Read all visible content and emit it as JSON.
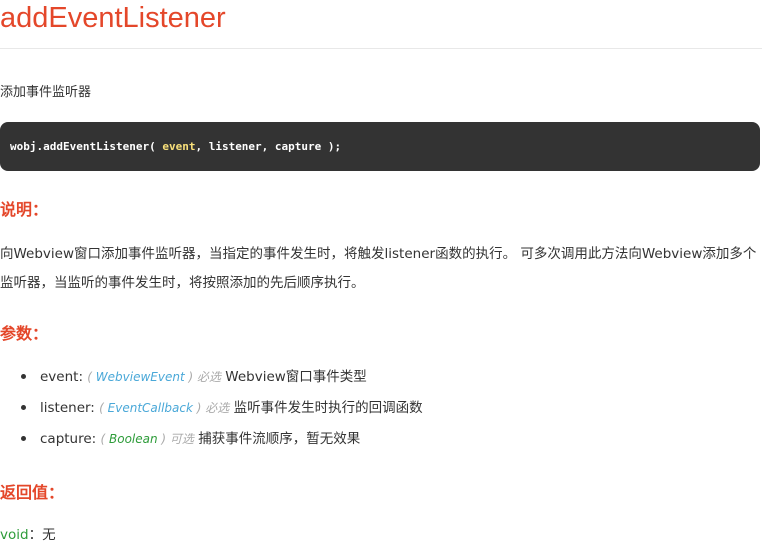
{
  "title": "addEventListener",
  "intro": "添加事件监听器",
  "code": {
    "prefix": "wobj.addEventListener( ",
    "arg": "event",
    "suffix": ", listener, capture );"
  },
  "description": {
    "heading": "说明：",
    "text": "向Webview窗口添加事件监听器，当指定的事件发生时，将触发listener函数的执行。 可多次调用此方法向Webview添加多个监听器，当监听的事件发生时，将按照添加的先后顺序执行。"
  },
  "params": {
    "heading": "参数：",
    "items": [
      {
        "name": "event: ",
        "open": "( ",
        "type": "WebviewEvent",
        "close": " ) ",
        "requirement": "必选",
        "desc": " Webview窗口事件类型"
      },
      {
        "name": "listener: ",
        "open": "( ",
        "type": "EventCallback",
        "close": " ) ",
        "requirement": "必选",
        "desc": " 监听事件发生时执行的回调函数"
      },
      {
        "name": "capture: ",
        "open": "( ",
        "type": "Boolean",
        "close": " ) ",
        "requirement": "可选",
        "desc": " 捕获事件流顺序，暂无效果"
      }
    ]
  },
  "returns": {
    "heading": "返回值：",
    "type": "void",
    "separator": "：",
    "value": "无"
  },
  "colors": {
    "heading": "#e4472a",
    "code_bg": "#333333",
    "code_arg": "#f9e07a",
    "type_link": "#4aa8d8",
    "type_boolean": "#2e9c3a",
    "muted": "#aaaaaa"
  }
}
